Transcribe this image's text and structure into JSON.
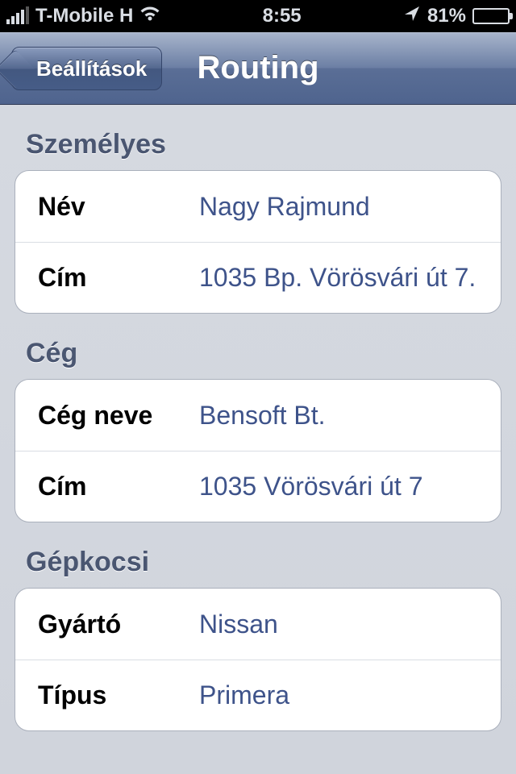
{
  "status": {
    "carrier": "T-Mobile H",
    "time": "8:55",
    "battery_percent": "81%"
  },
  "nav": {
    "back_label": "Beállítások",
    "title": "Routing"
  },
  "sections": {
    "personal": {
      "header": "Személyes",
      "name_label": "Név",
      "name_value": "Nagy Rajmund",
      "addr_label": "Cím",
      "addr_value": "1035 Bp. Vörösvári út 7."
    },
    "company": {
      "header": "Cég",
      "name_label": "Cég neve",
      "name_value": "Bensoft Bt.",
      "addr_label": "Cím",
      "addr_value": "1035 Vörösvári út 7"
    },
    "car": {
      "header": "Gépkocsi",
      "make_label": "Gyártó",
      "make_value": "Nissan",
      "model_label": "Típus",
      "model_value": "Primera"
    }
  }
}
